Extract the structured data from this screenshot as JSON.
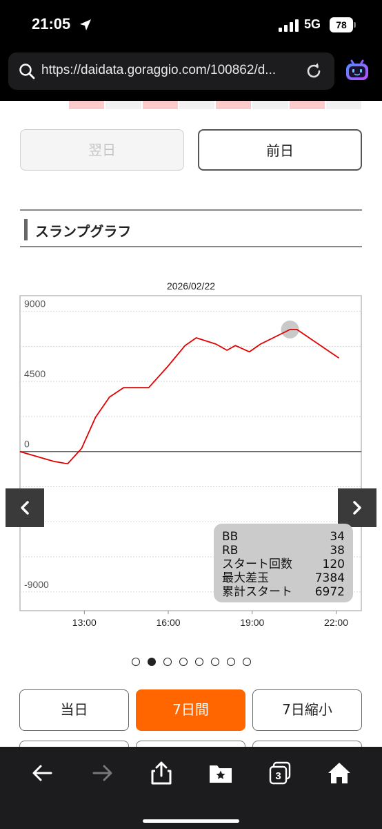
{
  "status_bar": {
    "time": "21:05",
    "network": "5G",
    "battery": "78"
  },
  "browser": {
    "url": "https://daidata.goraggio.com/100862/d...",
    "tab_count": "3"
  },
  "page": {
    "day_nav": {
      "next_label": "翌日",
      "prev_label": "前日"
    },
    "section_title": "スランプグラフ",
    "chart_date": "2026/02/22",
    "stats": [
      {
        "label": "BB",
        "value": "34"
      },
      {
        "label": "RB",
        "value": "38"
      },
      {
        "label": "スタート回数",
        "value": "120"
      },
      {
        "label": "最大差玉",
        "value": "7384"
      },
      {
        "label": "累計スタート",
        "value": "6972"
      }
    ],
    "pager": {
      "count": 8,
      "active_index": 1
    },
    "period_buttons": [
      {
        "label": "当日",
        "active": false
      },
      {
        "label": "7日間",
        "active": true
      },
      {
        "label": "7日縮小",
        "active": false
      }
    ]
  },
  "colors": {
    "accent": "#ff6600",
    "line": "#e00000",
    "highlight": "#f07070"
  },
  "chart_data": {
    "type": "line",
    "title": "2026/02/22",
    "x_unit": "hour",
    "xlim": [
      10.7,
      22.9
    ],
    "ylim": [
      -10200,
      10000
    ],
    "yticks": [
      9000,
      4500,
      0,
      -4500,
      -9000
    ],
    "ytick_labels": [
      "9000",
      "4500",
      "0",
      "",
      "-9000"
    ],
    "xticks": [
      13,
      16,
      19,
      22
    ],
    "xtick_labels": [
      "13:00",
      "16:00",
      "19:00",
      "22:00"
    ],
    "grid": true,
    "highlight_point": {
      "x": 20.35,
      "y": 7830
    },
    "series": [
      {
        "x": [
          10.7,
          11.9,
          12.4,
          12.9,
          13.4,
          13.9,
          14.4,
          15.3,
          16.0,
          16.6,
          17.0,
          17.7,
          18.1,
          18.4,
          18.9,
          19.3,
          20.35,
          20.6,
          22.1
        ],
        "y": [
          0,
          -620,
          -780,
          200,
          2200,
          3500,
          4100,
          4100,
          5500,
          6800,
          7300,
          6900,
          6500,
          6800,
          6400,
          6900,
          7830,
          7830,
          6000
        ]
      }
    ]
  }
}
